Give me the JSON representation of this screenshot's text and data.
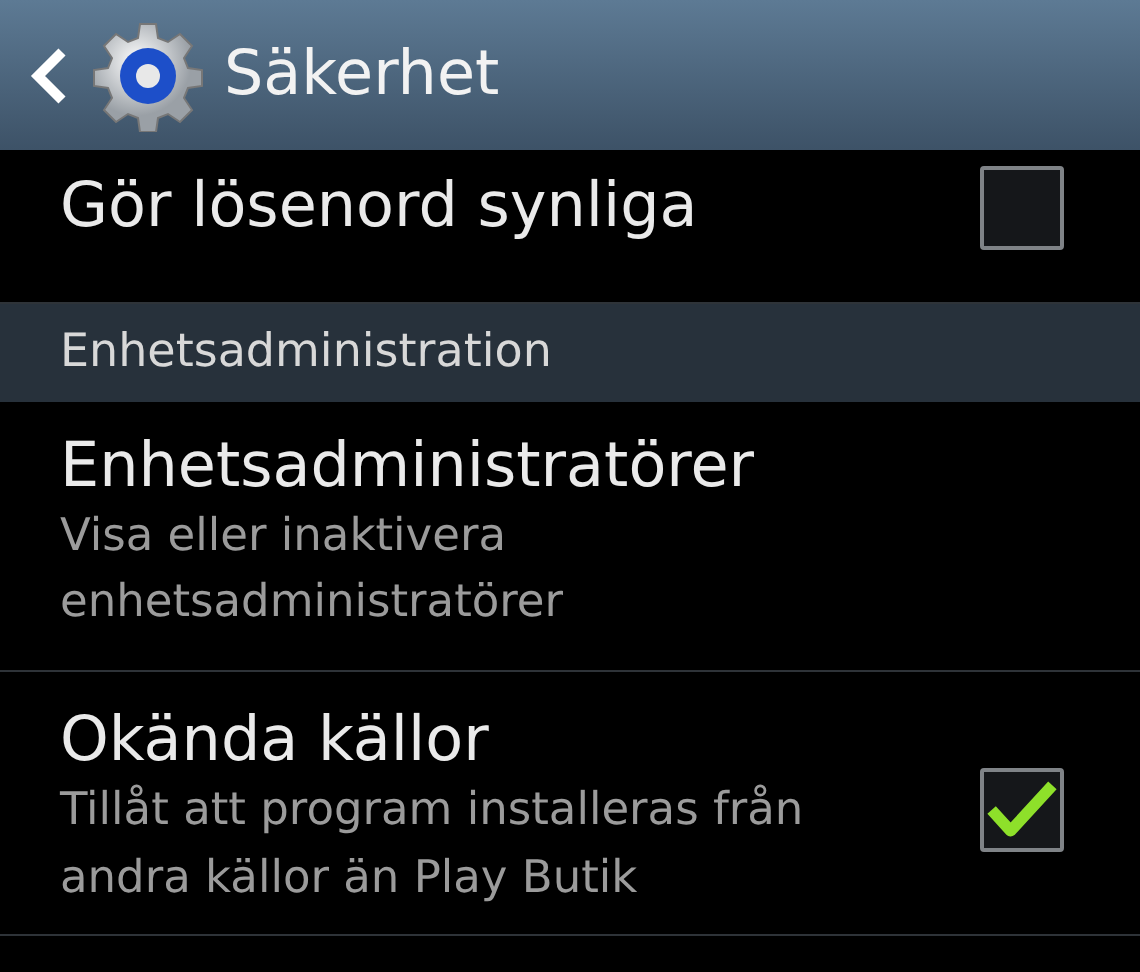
{
  "action_bar": {
    "title": "Säkerhet"
  },
  "items": [
    {
      "kind": "checkbox",
      "title": "Gör lösenord synliga",
      "checked": false
    },
    {
      "kind": "header",
      "title": "Enhetsadministration"
    },
    {
      "kind": "plain",
      "title": "Enhetsadministratörer",
      "summary": "Visa eller inaktivera enhetsadministratörer"
    },
    {
      "kind": "checkbox",
      "title": "Okända källor",
      "summary": "Tillåt att program installeras från andra källor än Play Butik",
      "checked": true
    }
  ]
}
